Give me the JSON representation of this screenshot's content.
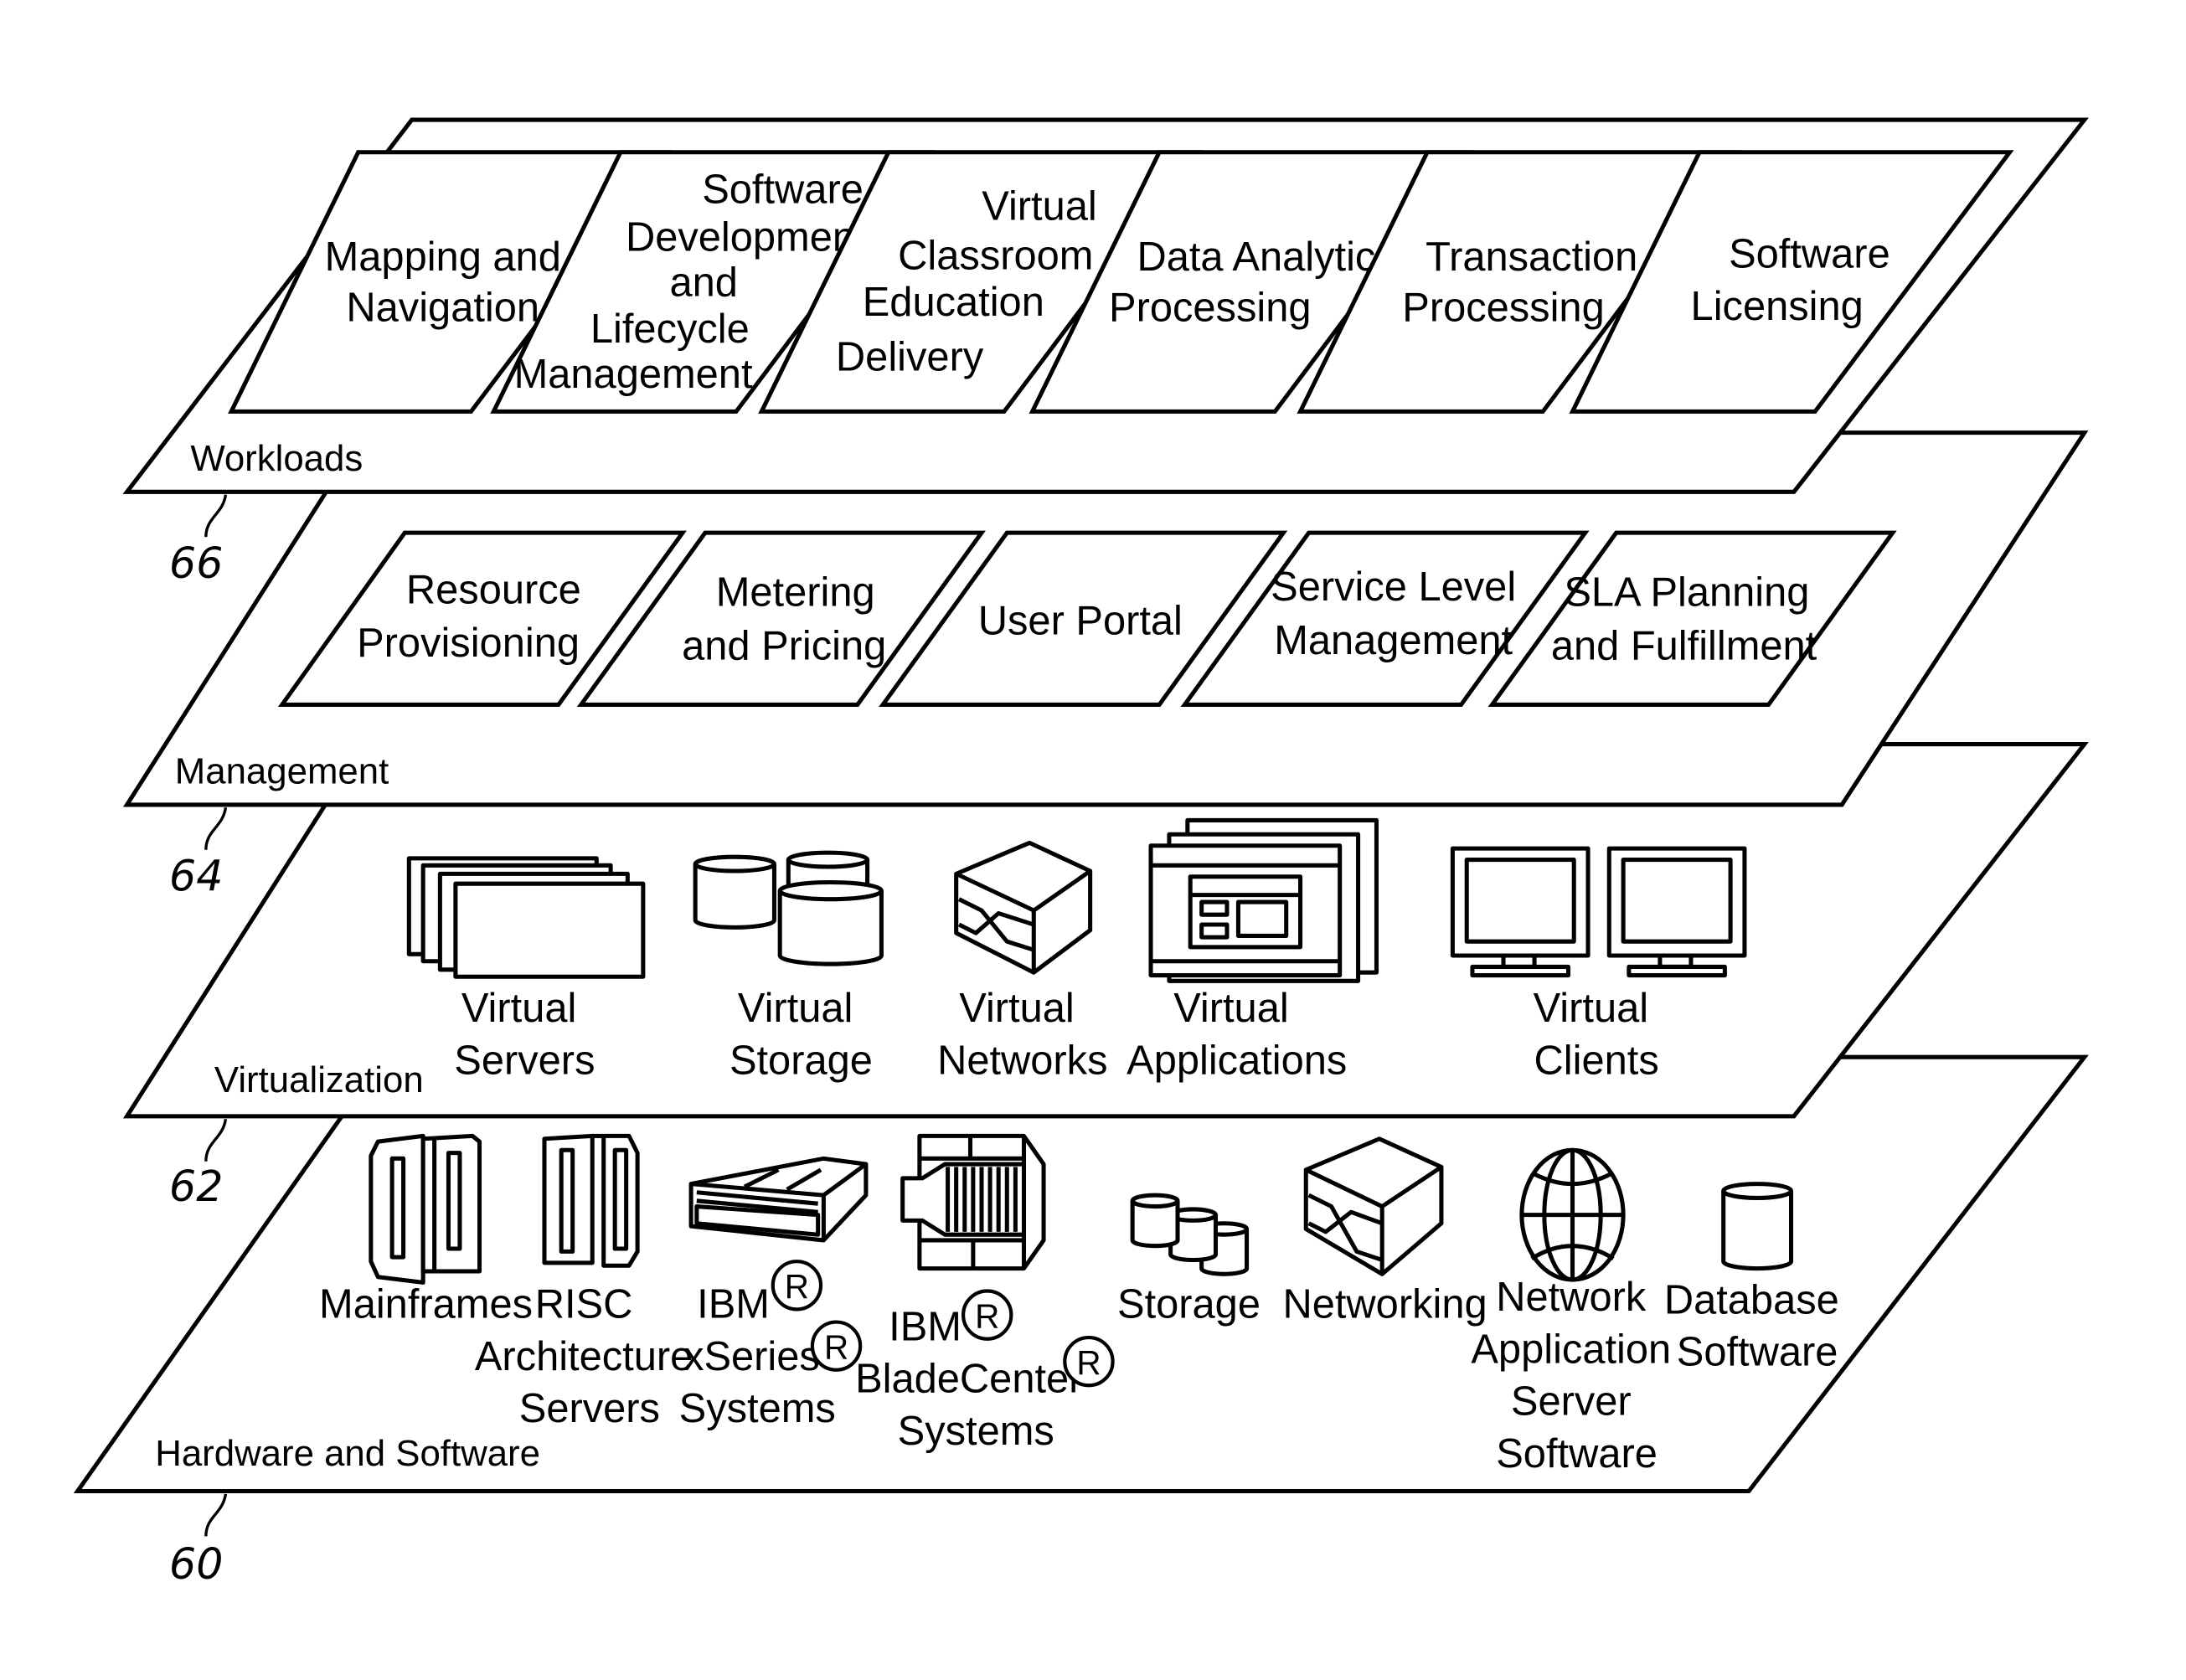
{
  "layers": [
    {
      "id": "workloads",
      "label": "Workloads",
      "ref": "66",
      "items": [
        {
          "name": "mapping-navigation",
          "lines": [
            "Mapping and",
            "Navigation"
          ]
        },
        {
          "name": "software-development",
          "lines": [
            "Software",
            "Development",
            "and",
            "Lifecycle",
            "Management"
          ]
        },
        {
          "name": "virtual-classroom",
          "lines": [
            "Virtual",
            "Classroom",
            "Education",
            "Delivery"
          ]
        },
        {
          "name": "data-analytics",
          "lines": [
            "Data Analytics",
            "Processing"
          ]
        },
        {
          "name": "transaction-processing",
          "lines": [
            "Transaction",
            "Processing"
          ]
        },
        {
          "name": "software-licensing",
          "lines": [
            "Software",
            "Licensing"
          ]
        }
      ]
    },
    {
      "id": "management",
      "label": "Management",
      "ref": "64",
      "items": [
        {
          "name": "resource-provisioning",
          "lines": [
            "Resource",
            "Provisioning"
          ]
        },
        {
          "name": "metering-pricing",
          "lines": [
            "Metering",
            "and Pricing"
          ]
        },
        {
          "name": "user-portal",
          "lines": [
            "User Portal"
          ]
        },
        {
          "name": "service-level-management",
          "lines": [
            "Service Level",
            "Management"
          ]
        },
        {
          "name": "sla-planning",
          "lines": [
            "SLA Planning",
            "and Fulfillment"
          ]
        }
      ]
    },
    {
      "id": "virtualization",
      "label": "Virtualization",
      "ref": "62",
      "items": [
        {
          "name": "virtual-servers",
          "icon": "stacked-servers-icon",
          "lines": [
            "Virtual",
            "Servers"
          ]
        },
        {
          "name": "virtual-storage",
          "icon": "storage-cylinders-icon",
          "lines": [
            "Virtual",
            "Storage"
          ]
        },
        {
          "name": "virtual-networks",
          "icon": "network-switch-icon",
          "lines": [
            "Virtual",
            "Networks"
          ]
        },
        {
          "name": "virtual-applications",
          "icon": "application-windows-icon",
          "lines": [
            "Virtual",
            "Applications"
          ]
        },
        {
          "name": "virtual-clients",
          "icon": "monitors-icon",
          "lines": [
            "Virtual",
            "Clients"
          ]
        }
      ]
    },
    {
      "id": "hardware-software",
      "label": "Hardware and Software",
      "ref": "60",
      "items": [
        {
          "name": "mainframes",
          "icon": "mainframe-icon",
          "lines": [
            "Mainframes"
          ]
        },
        {
          "name": "risc-servers",
          "icon": "risc-server-icon",
          "lines": [
            "RISC",
            "Architecture",
            "Servers"
          ]
        },
        {
          "name": "ibm-xseries",
          "icon": "xseries-server-icon",
          "lines": [
            "IBM",
            "xSeries",
            "Systems"
          ]
        },
        {
          "name": "ibm-bladecenter",
          "icon": "bladecenter-icon",
          "lines": [
            "IBM",
            "BladeCenter",
            "Systems"
          ]
        },
        {
          "name": "storage",
          "icon": "storage-cylinders-icon",
          "lines": [
            "Storage"
          ]
        },
        {
          "name": "networking",
          "icon": "network-switch-icon",
          "lines": [
            "Networking"
          ]
        },
        {
          "name": "network-app-server",
          "icon": "globe-icon",
          "lines": [
            "Network",
            "Application",
            "Server",
            "Software"
          ]
        },
        {
          "name": "database-software",
          "icon": "database-icon",
          "lines": [
            "Database",
            "Software"
          ]
        }
      ]
    }
  ],
  "registered_mark": "R"
}
